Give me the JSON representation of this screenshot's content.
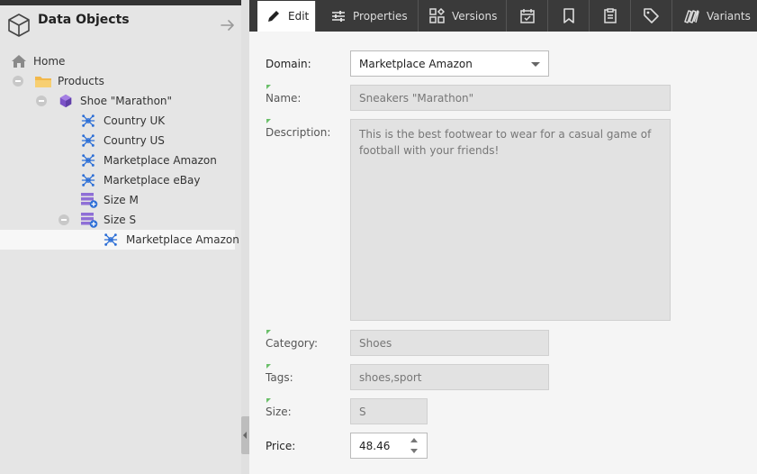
{
  "sidebar": {
    "title": "Data Objects",
    "tree": [
      {
        "label": "Home",
        "icon": "home-icon"
      },
      {
        "label": "Products",
        "icon": "folder-icon"
      },
      {
        "label": "Shoe \"Marathon\"",
        "icon": "object-cube-icon"
      },
      {
        "label": "Country UK",
        "icon": "variant-node-icon"
      },
      {
        "label": "Country US",
        "icon": "variant-node-icon"
      },
      {
        "label": "Marketplace Amazon",
        "icon": "variant-node-icon"
      },
      {
        "label": "Marketplace eBay",
        "icon": "variant-node-icon"
      },
      {
        "label": "Size M",
        "icon": "stack-variant-icon"
      },
      {
        "label": "Size S",
        "icon": "stack-variant-icon"
      },
      {
        "label": "Marketplace Amazon",
        "icon": "variant-node-icon",
        "selected": true
      }
    ]
  },
  "tabs": [
    {
      "label": "Edit",
      "icon": "pencil-icon",
      "active": true
    },
    {
      "label": "Properties",
      "icon": "sliders-icon"
    },
    {
      "label": "Versions",
      "icon": "versions-grid-icon"
    },
    {
      "label": "",
      "icon": "calendar-check-icon"
    },
    {
      "label": "",
      "icon": "bookmark-icon"
    },
    {
      "label": "",
      "icon": "clipboard-icon"
    },
    {
      "label": "",
      "icon": "tag-icon"
    },
    {
      "label": "Variants",
      "icon": "variants-icon"
    }
  ],
  "form": {
    "domain_label": "Domain:",
    "domain_value": "Marketplace Amazon",
    "name_label": "Name:",
    "name_value": "Sneakers \"Marathon\"",
    "description_label": "Description:",
    "description_value": "This is the best footwear to wear for a casual game of football with your friends!",
    "category_label": "Category:",
    "category_value": "Shoes",
    "tags_label": "Tags:",
    "tags_value": "shoes,sport",
    "size_label": "Size:",
    "size_value": "S",
    "price_label": "Price:",
    "price_value": "48.46"
  },
  "colors": {
    "accent_blue": "#2d6fd6",
    "object_purple": "#7b52c7",
    "inherited_marker": "#6abf69",
    "tabbar_bg": "#3a3a3a"
  }
}
